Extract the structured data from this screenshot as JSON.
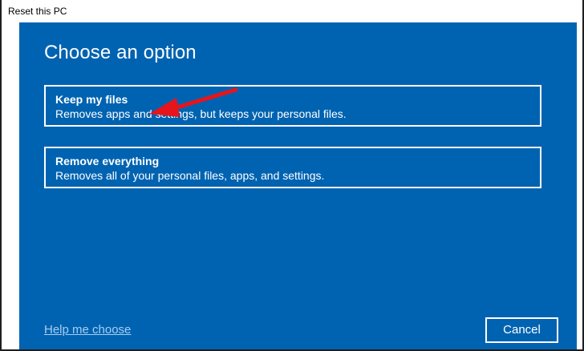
{
  "window": {
    "title": "Reset this PC"
  },
  "dialog": {
    "heading": "Choose an option",
    "options": [
      {
        "title": "Keep my files",
        "description": "Removes apps and settings, but keeps your personal files."
      },
      {
        "title": "Remove everything",
        "description": "Removes all of your personal files, apps, and settings."
      }
    ],
    "help_link": "Help me choose",
    "cancel_label": "Cancel"
  },
  "colors": {
    "background": "#0063b1",
    "text": "#ffffff",
    "link": "#a9cdf0",
    "annotation_arrow": "#e8141b"
  }
}
